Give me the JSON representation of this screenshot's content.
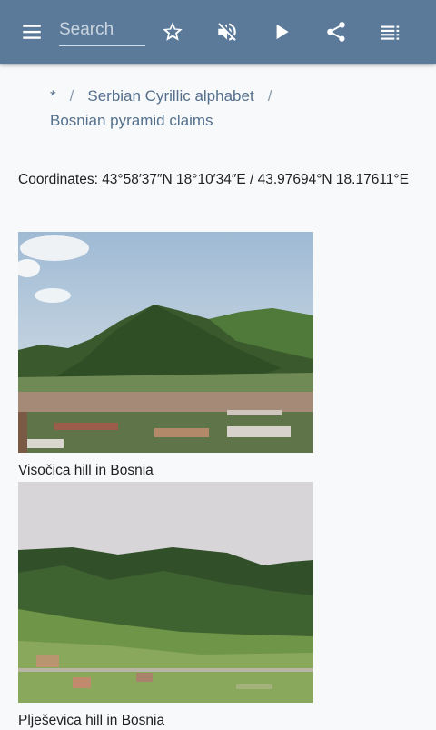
{
  "toolbar": {
    "search_placeholder": "Search",
    "icons": [
      "menu-icon",
      "star-icon",
      "volume-off-icon",
      "play-icon",
      "share-icon",
      "toc-icon"
    ],
    "colors": {
      "bar": "#5b7a99",
      "icon": "#ffffff"
    }
  },
  "breadcrumb": {
    "items": [
      {
        "label": "*"
      },
      {
        "label": "Serbian Cyrillic alphabet"
      },
      {
        "label": "Bosnian pyramid claims"
      }
    ],
    "separator": "/"
  },
  "article": {
    "coordinates": "Coordinates: 43°58′37″N 18°10′34″E / 43.97694°N 18.17611°E",
    "figures": [
      {
        "caption": "Visočica hill in Bosnia"
      },
      {
        "caption": "Plješevica hill in Bosnia"
      }
    ]
  }
}
